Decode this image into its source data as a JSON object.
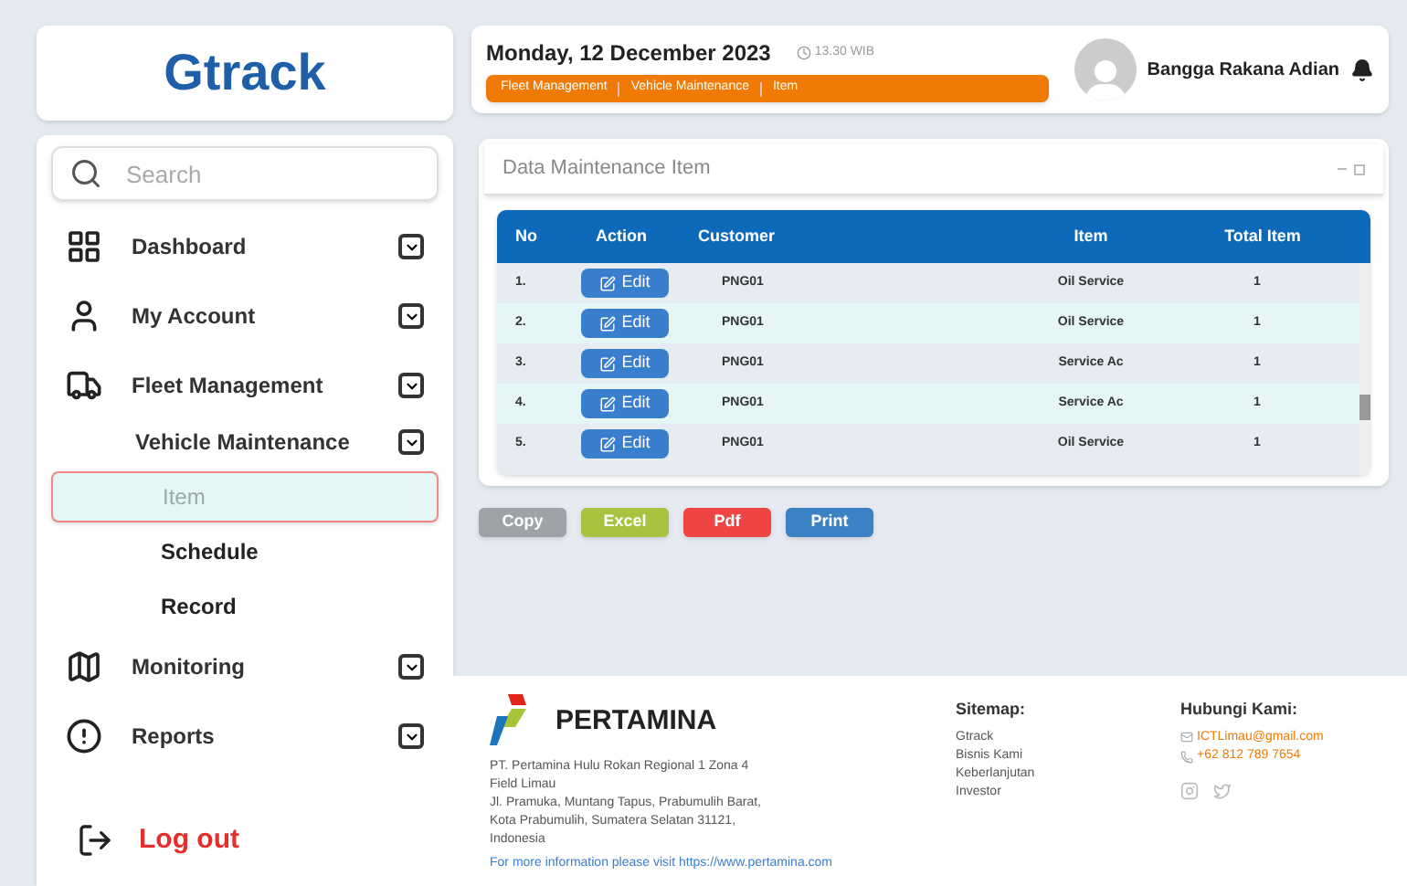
{
  "logo": "Gtrack",
  "header": {
    "date": "Monday, 12 December 2023",
    "time": "13.30 WIB",
    "breadcrumb": [
      "Fleet Management",
      "Vehicle Maintenance",
      "Item"
    ],
    "user": "Bangga Rakana Adian"
  },
  "search": {
    "placeholder": "Search"
  },
  "nav": [
    {
      "label": "Dashboard"
    },
    {
      "label": "My Account"
    },
    {
      "label": "Fleet Management",
      "children": [
        {
          "label": "Vehicle Maintenance",
          "children": [
            {
              "label": "Item",
              "selected": true
            },
            {
              "label": "Schedule",
              "selected": false
            },
            {
              "label": "Record",
              "selected": false
            }
          ]
        }
      ]
    },
    {
      "label": "Monitoring"
    },
    {
      "label": "Reports"
    }
  ],
  "logout": "Log out",
  "panel": {
    "title": "Data Maintenance Item"
  },
  "table": {
    "columns": [
      "No",
      "Action",
      "Customer",
      "Item",
      "Total Item"
    ],
    "rows": [
      {
        "no": "1.",
        "action": "Edit",
        "customer": "PNG01",
        "item": "Oil Service",
        "total": "1"
      },
      {
        "no": "2.",
        "action": "Edit",
        "customer": "PNG01",
        "item": "Oil Service",
        "total": "1"
      },
      {
        "no": "3.",
        "action": "Edit",
        "customer": "PNG01",
        "item": "Service Ac",
        "total": "1"
      },
      {
        "no": "4.",
        "action": "Edit",
        "customer": "PNG01",
        "item": "Service Ac",
        "total": "1"
      },
      {
        "no": "5.",
        "action": "Edit",
        "customer": "PNG01",
        "item": "Oil Service",
        "total": "1"
      }
    ]
  },
  "export_buttons": [
    {
      "label": "Copy",
      "color": "#9ea3a8"
    },
    {
      "label": "Excel",
      "color": "#a9c23f"
    },
    {
      "label": "Pdf",
      "color": "#ef4444"
    },
    {
      "label": "Print",
      "color": "#3b82c4"
    }
  ],
  "footer": {
    "brand": "PERTAMINA",
    "address": [
      "PT. Pertamina Hulu Rokan Regional 1 Zona 4",
      "Field Limau",
      "Jl. Pramuka, Muntang Tapus, Prabumulih Barat,",
      "Kota Prabumulih, Sumatera Selatan 31121,",
      "Indonesia"
    ],
    "more_info": "For more information please visit https://www.pertamina.com",
    "sitemap_title": "Sitemap:",
    "sitemap": [
      "Gtrack",
      "Bisnis Kami",
      "Keberlanjutan",
      "Investor"
    ],
    "contact_title": "Hubungi Kami:",
    "email": "ICTLimau@gmail.com",
    "phone": "+62 812 789 7654"
  }
}
